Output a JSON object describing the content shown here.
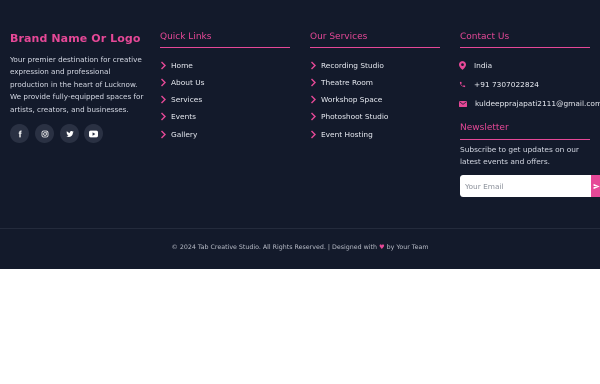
{
  "brand": {
    "name": "Brand Name Or Logo",
    "description": "Your premier destination for creative expression and professional production in the heart of Lucknow. We provide fully-equipped spaces for artists, creators, and businesses."
  },
  "social": [
    {
      "name": "facebook-icon"
    },
    {
      "name": "instagram-icon"
    },
    {
      "name": "twitter-icon"
    },
    {
      "name": "youtube-icon"
    }
  ],
  "quick_links": {
    "title": "Quick Links",
    "items": [
      "Home",
      "About Us",
      "Services",
      "Events",
      "Gallery"
    ]
  },
  "services": {
    "title": "Our Services",
    "items": [
      "Recording Studio",
      "Theatre Room",
      "Workshop Space",
      "Photoshoot Studio",
      "Event Hosting"
    ]
  },
  "contact": {
    "title": "Contact Us",
    "location": "India",
    "phone": "+91 7307022824",
    "email": "kuldeepprajapati2111@gmail.com"
  },
  "newsletter": {
    "title": "Newsletter",
    "text": "Subscribe to get updates on our latest events and offers.",
    "placeholder": "Your Email"
  },
  "footer_bottom": {
    "prefix": "© 2024 Tab Creative Studio. All Rights Reserved. | Designed with",
    "heart": "♥",
    "suffix": "by Your Team"
  },
  "colors": {
    "background": "#131a2b",
    "accent": "#e64897",
    "text": "#e8ebf2",
    "social_bg": "#2a3143",
    "page": "#ffffff"
  }
}
